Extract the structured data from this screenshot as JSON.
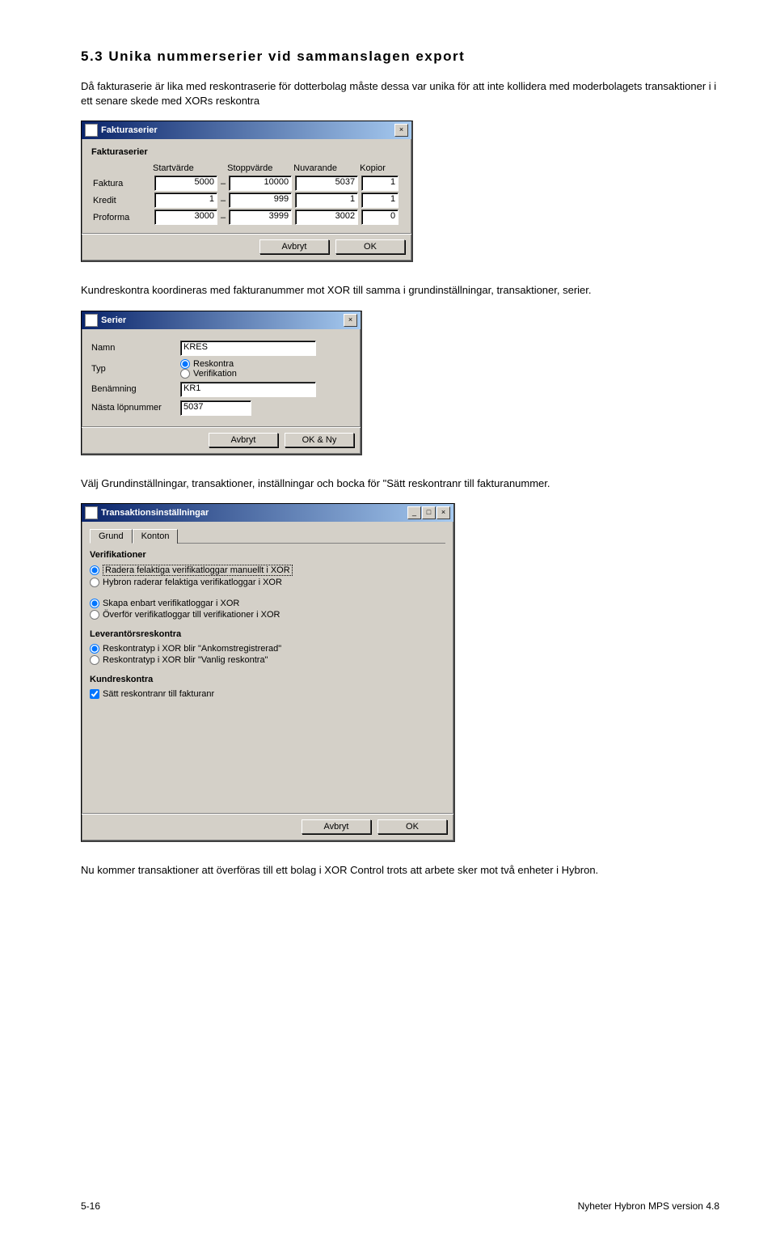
{
  "heading": "5.3  Unika nummerserier vid sammanslagen export",
  "para1": "Då fakturaserie är lika med reskontraserie för dotterbolag måste dessa var unika för att inte kollidera med moderbolagets transaktioner i i ett senare skede med XORs reskontra",
  "para2": "Kundreskontra koordineras med fakturanummer mot XOR till samma i grundinställningar, transaktioner, serier.",
  "para3": "Välj Grundinställningar, transaktioner, inställningar och bocka för \"Sätt reskontranr till fakturanummer.",
  "para4": "Nu kommer transaktioner att överföras till ett bolag i XOR Control trots att arbete sker mot två enheter i Hybron.",
  "dlg1": {
    "title": "Fakturaserier",
    "section": "Fakturaserier",
    "headers": {
      "start": "Startvärde",
      "stop": "Stoppvärde",
      "curr": "Nuvarande",
      "copies": "Kopior"
    },
    "rows": [
      {
        "name": "Faktura",
        "start": "5000",
        "stop": "10000",
        "curr": "5037",
        "copies": "1"
      },
      {
        "name": "Kredit",
        "start": "1",
        "stop": "999",
        "curr": "1",
        "copies": "1"
      },
      {
        "name": "Proforma",
        "start": "3000",
        "stop": "3999",
        "curr": "3002",
        "copies": "0"
      }
    ],
    "btn_cancel": "Avbryt",
    "btn_ok": "OK"
  },
  "dlg2": {
    "title": "Serier",
    "labels": {
      "name": "Namn",
      "type": "Typ",
      "desc": "Benämning",
      "next": "Nästa löpnummer"
    },
    "values": {
      "name": "KRES",
      "desc": "KR1",
      "next": "5037"
    },
    "types": {
      "reskontra": "Reskontra",
      "verifikation": "Verifikation"
    },
    "btn_cancel": "Avbryt",
    "btn_okny": "OK & Ny"
  },
  "dlg3": {
    "title": "Transaktionsinställningar",
    "tabs": {
      "grund": "Grund",
      "konton": "Konton"
    },
    "sections": {
      "verif": "Verifikationer",
      "lev": "Leverantörsreskontra",
      "kund": "Kundreskontra"
    },
    "opts": {
      "v1": "Radera felaktiga verifikatloggar manuellt i XOR",
      "v2": "Hybron raderar felaktiga verifikatloggar i XOR",
      "v3": "Skapa enbart verifikatloggar i XOR",
      "v4": "Överför verifikatloggar till verifikationer i XOR",
      "l1": "Reskontratyp i XOR blir \"Ankomstregistrerad\"",
      "l2": "Reskontratyp i XOR blir \"Vanlig reskontra\"",
      "k1": "Sätt reskontranr till fakturanr"
    },
    "btn_cancel": "Avbryt",
    "btn_ok": "OK"
  },
  "footer": {
    "page": "5-16",
    "doctitle": "Nyheter Hybron MPS version 4.8"
  }
}
